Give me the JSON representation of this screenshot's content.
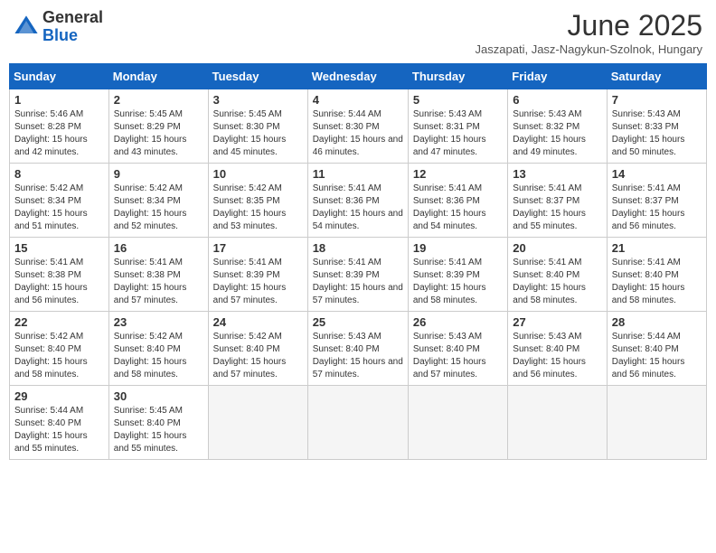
{
  "header": {
    "logo_general": "General",
    "logo_blue": "Blue",
    "month_title": "June 2025",
    "subtitle": "Jaszapati, Jasz-Nagykun-Szolnok, Hungary"
  },
  "weekdays": [
    "Sunday",
    "Monday",
    "Tuesday",
    "Wednesday",
    "Thursday",
    "Friday",
    "Saturday"
  ],
  "weeks": [
    [
      {
        "day": "1",
        "sunrise": "5:46 AM",
        "sunset": "8:28 PM",
        "daylight": "Daylight: 15 hours and 42 minutes."
      },
      {
        "day": "2",
        "sunrise": "5:45 AM",
        "sunset": "8:29 PM",
        "daylight": "Daylight: 15 hours and 43 minutes."
      },
      {
        "day": "3",
        "sunrise": "5:45 AM",
        "sunset": "8:30 PM",
        "daylight": "Daylight: 15 hours and 45 minutes."
      },
      {
        "day": "4",
        "sunrise": "5:44 AM",
        "sunset": "8:30 PM",
        "daylight": "Daylight: 15 hours and 46 minutes."
      },
      {
        "day": "5",
        "sunrise": "5:43 AM",
        "sunset": "8:31 PM",
        "daylight": "Daylight: 15 hours and 47 minutes."
      },
      {
        "day": "6",
        "sunrise": "5:43 AM",
        "sunset": "8:32 PM",
        "daylight": "Daylight: 15 hours and 49 minutes."
      },
      {
        "day": "7",
        "sunrise": "5:43 AM",
        "sunset": "8:33 PM",
        "daylight": "Daylight: 15 hours and 50 minutes."
      }
    ],
    [
      {
        "day": "8",
        "sunrise": "5:42 AM",
        "sunset": "8:34 PM",
        "daylight": "Daylight: 15 hours and 51 minutes."
      },
      {
        "day": "9",
        "sunrise": "5:42 AM",
        "sunset": "8:34 PM",
        "daylight": "Daylight: 15 hours and 52 minutes."
      },
      {
        "day": "10",
        "sunrise": "5:42 AM",
        "sunset": "8:35 PM",
        "daylight": "Daylight: 15 hours and 53 minutes."
      },
      {
        "day": "11",
        "sunrise": "5:41 AM",
        "sunset": "8:36 PM",
        "daylight": "Daylight: 15 hours and 54 minutes."
      },
      {
        "day": "12",
        "sunrise": "5:41 AM",
        "sunset": "8:36 PM",
        "daylight": "Daylight: 15 hours and 54 minutes."
      },
      {
        "day": "13",
        "sunrise": "5:41 AM",
        "sunset": "8:37 PM",
        "daylight": "Daylight: 15 hours and 55 minutes."
      },
      {
        "day": "14",
        "sunrise": "5:41 AM",
        "sunset": "8:37 PM",
        "daylight": "Daylight: 15 hours and 56 minutes."
      }
    ],
    [
      {
        "day": "15",
        "sunrise": "5:41 AM",
        "sunset": "8:38 PM",
        "daylight": "Daylight: 15 hours and 56 minutes."
      },
      {
        "day": "16",
        "sunrise": "5:41 AM",
        "sunset": "8:38 PM",
        "daylight": "Daylight: 15 hours and 57 minutes."
      },
      {
        "day": "17",
        "sunrise": "5:41 AM",
        "sunset": "8:39 PM",
        "daylight": "Daylight: 15 hours and 57 minutes."
      },
      {
        "day": "18",
        "sunrise": "5:41 AM",
        "sunset": "8:39 PM",
        "daylight": "Daylight: 15 hours and 57 minutes."
      },
      {
        "day": "19",
        "sunrise": "5:41 AM",
        "sunset": "8:39 PM",
        "daylight": "Daylight: 15 hours and 58 minutes."
      },
      {
        "day": "20",
        "sunrise": "5:41 AM",
        "sunset": "8:40 PM",
        "daylight": "Daylight: 15 hours and 58 minutes."
      },
      {
        "day": "21",
        "sunrise": "5:41 AM",
        "sunset": "8:40 PM",
        "daylight": "Daylight: 15 hours and 58 minutes."
      }
    ],
    [
      {
        "day": "22",
        "sunrise": "5:42 AM",
        "sunset": "8:40 PM",
        "daylight": "Daylight: 15 hours and 58 minutes."
      },
      {
        "day": "23",
        "sunrise": "5:42 AM",
        "sunset": "8:40 PM",
        "daylight": "Daylight: 15 hours and 58 minutes."
      },
      {
        "day": "24",
        "sunrise": "5:42 AM",
        "sunset": "8:40 PM",
        "daylight": "Daylight: 15 hours and 57 minutes."
      },
      {
        "day": "25",
        "sunrise": "5:43 AM",
        "sunset": "8:40 PM",
        "daylight": "Daylight: 15 hours and 57 minutes."
      },
      {
        "day": "26",
        "sunrise": "5:43 AM",
        "sunset": "8:40 PM",
        "daylight": "Daylight: 15 hours and 57 minutes."
      },
      {
        "day": "27",
        "sunrise": "5:43 AM",
        "sunset": "8:40 PM",
        "daylight": "Daylight: 15 hours and 56 minutes."
      },
      {
        "day": "28",
        "sunrise": "5:44 AM",
        "sunset": "8:40 PM",
        "daylight": "Daylight: 15 hours and 56 minutes."
      }
    ],
    [
      {
        "day": "29",
        "sunrise": "5:44 AM",
        "sunset": "8:40 PM",
        "daylight": "Daylight: 15 hours and 55 minutes."
      },
      {
        "day": "30",
        "sunrise": "5:45 AM",
        "sunset": "8:40 PM",
        "daylight": "Daylight: 15 hours and 55 minutes."
      },
      null,
      null,
      null,
      null,
      null
    ]
  ]
}
